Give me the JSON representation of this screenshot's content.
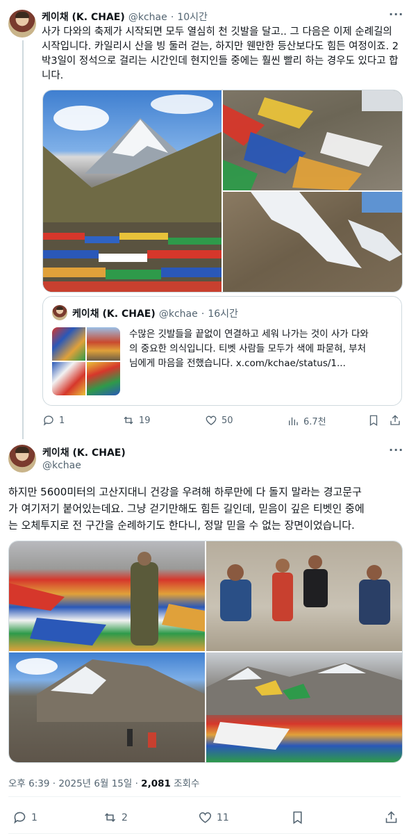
{
  "tweet1": {
    "author_name": "케이채 (K. CHAE)",
    "handle": "@kchae",
    "time": "10시간",
    "text_lines": [
      "사가 다와의 축제가 시작되면 모두 열심히 천 깃발을 달고.. 그 다음은 이제 순례길의",
      "시작입니다. 카일리시 산을 빙 둘러 걷는, 하지만 웬만한 등산보다도 힘든 여정이죠. 2",
      "박3일이 정석으로 걸리는 시간인데 현지인들 중에는 훨씬 빨리 하는 경우도 있다고 합",
      "니다."
    ],
    "images": [
      "snow-peak-mountain-with-prayer-flags",
      "prayer-flags-on-rocky-slope",
      "snowy-rocky-slope"
    ],
    "quote": {
      "author_name": "케이채 (K. CHAE)",
      "handle": "@kchae",
      "time": "16시간",
      "text_lines": [
        "수많은 깃발들을 끝없이 연결하고 세워 나가는 것이 사가 다와",
        "의 중요한 의식입니다. 티벳 사람들 모두가 색에 파묻혀, 부처",
        "님에게 마음을 전했습니다.  x.com/kchae/status/1..."
      ]
    },
    "actions": {
      "replies": "1",
      "reposts": "19",
      "likes": "50",
      "views": "6.7천"
    }
  },
  "tweet2": {
    "author_name": "케이채 (K. CHAE)",
    "handle": "@kchae",
    "text_lines": [
      "하지만 5600미터의 고산지대니 건강을 우려해 하루만에 다 돌지 말라는 경고문구",
      "가 여기저기 붙어있는데요. 그냥 걷기만해도 힘든 길인데, 믿음이 깊은 티벳인 중에",
      "는 오체투지로 전 구간을 순례하기도 한다니, 정말 믿을 수 없는 장면이었습니다."
    ],
    "images": [
      "pilgrim-among-prayer-flags",
      "tibetan-family-sitting",
      "rocky-mountain-hikers",
      "prayer-flags-field-mountains"
    ],
    "timestamp": "오후 6:39 · 2025년 6월 15일 · ",
    "views_count": "2,081",
    "views_label": " 조회수",
    "actions": {
      "replies": "1",
      "reposts": "2",
      "likes": "11"
    }
  },
  "colors": {
    "text": "#0f1419",
    "muted": "#536471",
    "border": "#cfd9de"
  },
  "icons": [
    "more-icon",
    "reply-icon",
    "repost-icon",
    "like-icon",
    "views-icon",
    "bookmark-icon",
    "share-icon"
  ]
}
